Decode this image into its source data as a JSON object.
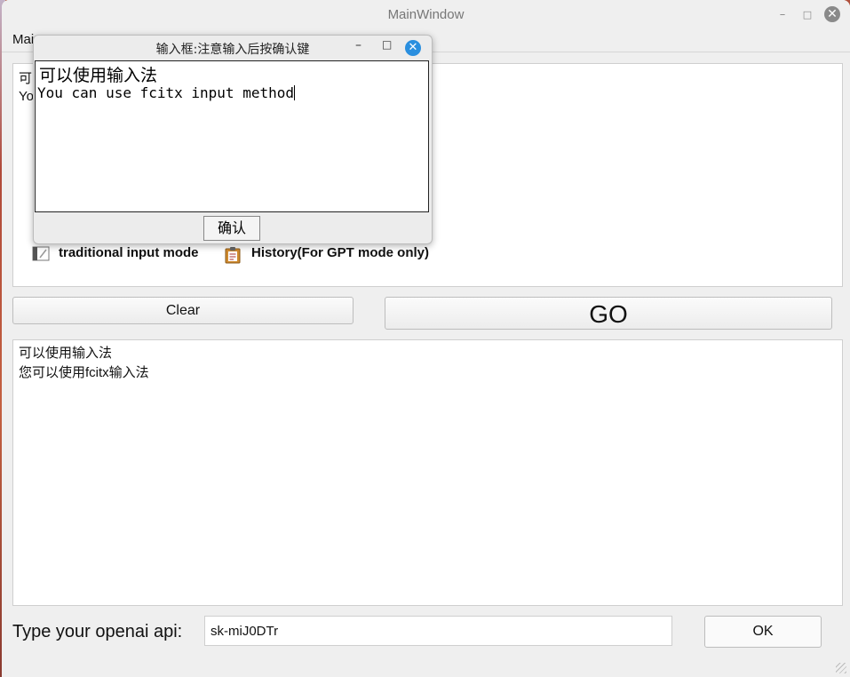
{
  "window": {
    "title": "MainWindow",
    "min_icon": "minimize-icon",
    "max_icon": "maximize-icon",
    "close_icon": "close-icon"
  },
  "menubar": {
    "menu_label": "Mai"
  },
  "top_pane": {
    "line1_partial": "可",
    "line2_partial": "Yo"
  },
  "options": {
    "traditional_label": "traditional input mode",
    "history_label": "History(For GPT mode only)"
  },
  "buttons": {
    "clear_label": "Clear",
    "go_label": "GO",
    "ok_label": "OK"
  },
  "output": {
    "line1": "可以使用输入法",
    "line2": "您可以使用fcitx输入法"
  },
  "api": {
    "label": "Type your openai api:",
    "value": "sk-miJ0DTr"
  },
  "dialog": {
    "title": "输入框:注意输入后按确认键",
    "line1": "可以使用输入法",
    "line2": "You can use fcitx input method",
    "confirm_label": "确认"
  }
}
